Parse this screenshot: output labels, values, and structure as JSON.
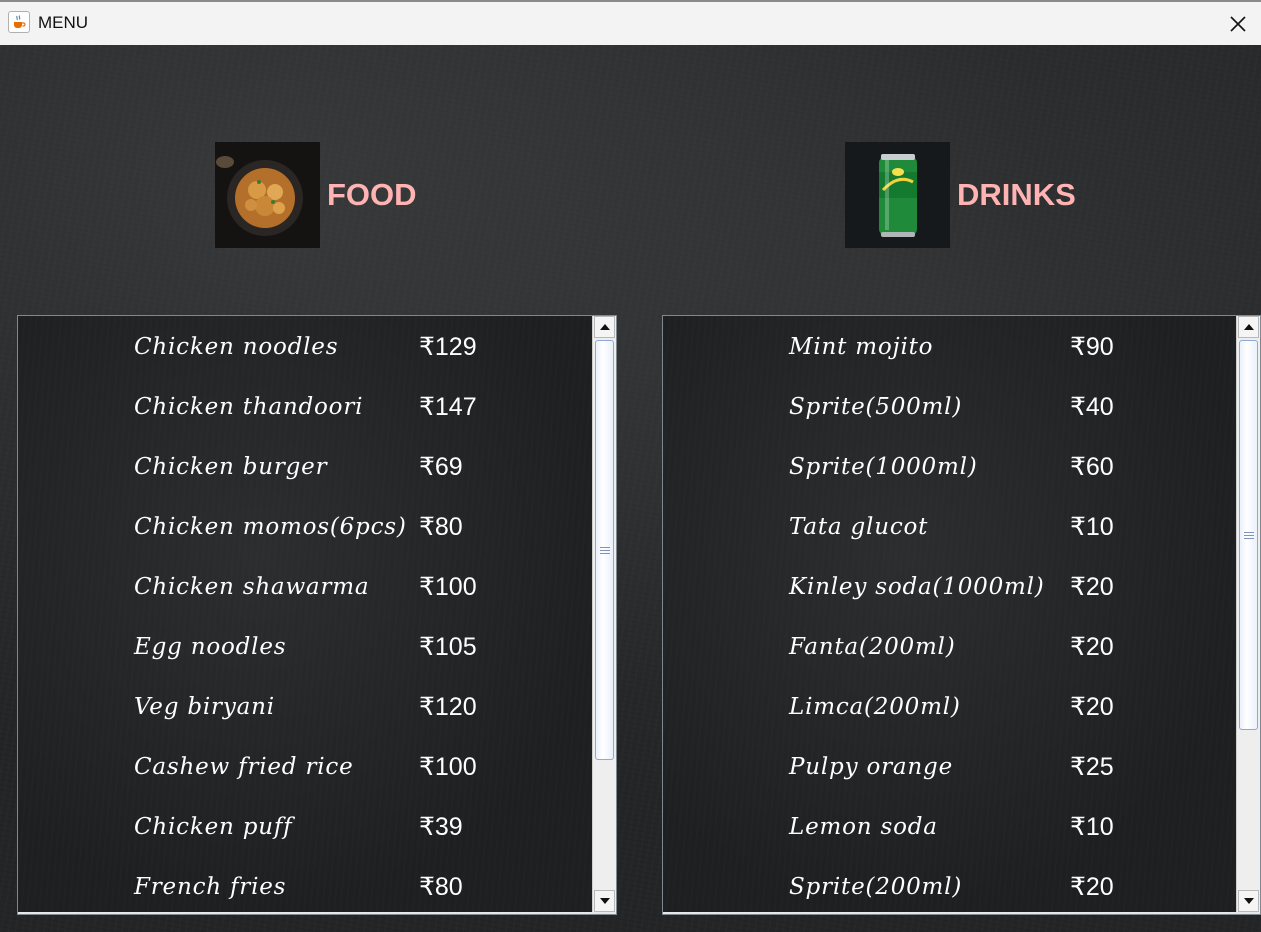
{
  "window": {
    "title": "MENU"
  },
  "food": {
    "heading": "FOOD",
    "items": [
      {
        "name": "Chicken noodles",
        "price": "₹129"
      },
      {
        "name": "Chicken thandoori",
        "price": "₹147"
      },
      {
        "name": "Chicken burger",
        "price": "₹69"
      },
      {
        "name": "Chicken momos(6pcs)",
        "price": "₹80"
      },
      {
        "name": "Chicken shawarma",
        "price": "₹100"
      },
      {
        "name": "Egg noodles",
        "price": "₹105"
      },
      {
        "name": "Veg biryani",
        "price": "₹120"
      },
      {
        "name": "Cashew fried rice",
        "price": "₹100"
      },
      {
        "name": "Chicken puff",
        "price": "₹39"
      },
      {
        "name": "French fries",
        "price": "₹80"
      }
    ]
  },
  "drinks": {
    "heading": "DRINKS",
    "items": [
      {
        "name": "Mint mojito",
        "price": "₹90"
      },
      {
        "name": "Sprite(500ml)",
        "price": "₹40"
      },
      {
        "name": "Sprite(1000ml)",
        "price": "₹60"
      },
      {
        "name": "Tata glucot",
        "price": "₹10"
      },
      {
        "name": "Kinley soda(1000ml)",
        "price": "₹20"
      },
      {
        "name": "Fanta(200ml)",
        "price": "₹20"
      },
      {
        "name": "Limca(200ml)",
        "price": "₹20"
      },
      {
        "name": "Pulpy orange",
        "price": "₹25"
      },
      {
        "name": "Lemon soda",
        "price": "₹10"
      },
      {
        "name": "Sprite(200ml)",
        "price": "₹20"
      }
    ]
  },
  "colors": {
    "heading": "#ffb3b3",
    "background": "#232526",
    "text": "#ffffff"
  },
  "icons": {
    "app": "java-cup-icon",
    "close": "close-icon",
    "food": "biryani-plate-icon",
    "drinks": "sprite-can-icon"
  }
}
